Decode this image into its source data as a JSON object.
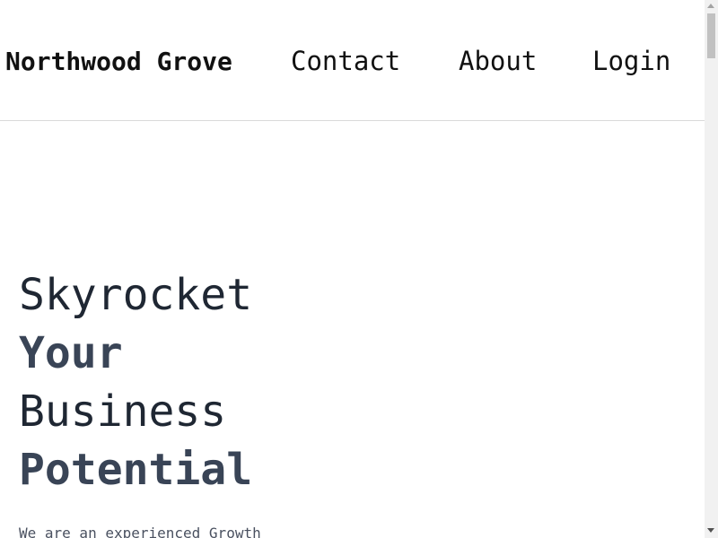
{
  "header": {
    "brand": "Northwood Grove",
    "nav": [
      {
        "label": "Contact"
      },
      {
        "label": "About"
      },
      {
        "label": "Login"
      }
    ]
  },
  "hero": {
    "lines": [
      "Skyrocket",
      "Your",
      "Business",
      "Potential"
    ],
    "description": "We are an experienced Growth"
  },
  "colors": {
    "text_dark": "#111111",
    "hero_light": "#1f2733",
    "hero_bold": "#394456",
    "divider": "#d9d9d9"
  }
}
